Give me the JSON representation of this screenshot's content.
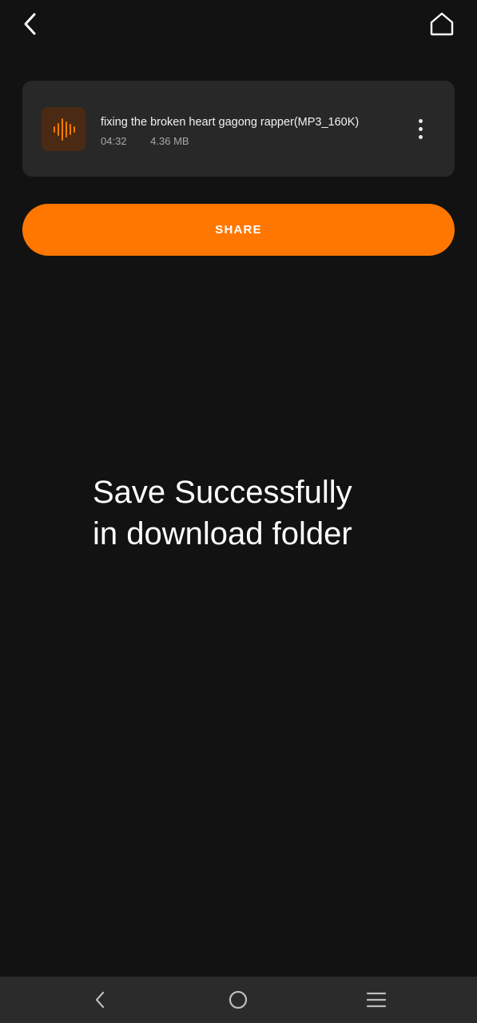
{
  "header": {
    "back_icon": "chevron-left-icon",
    "home_icon": "home-icon"
  },
  "file": {
    "icon": "audio-waveform-icon",
    "title": "fixing the broken heart gagong rapper(MP3_160K)",
    "duration": "04:32",
    "size": "4.36 MB",
    "menu_icon": "more-vertical-icon"
  },
  "share": {
    "label": "SHARE"
  },
  "status": {
    "line1": "Save Successfully",
    "line2": "in download folder"
  },
  "system_nav": {
    "back_icon": "nav-back-icon",
    "home_icon": "nav-home-icon",
    "menu_icon": "nav-menu-icon"
  },
  "colors": {
    "background": "#121212",
    "card": "#282828",
    "accent": "#ff7700",
    "nav_bar": "#2b2b2b"
  }
}
